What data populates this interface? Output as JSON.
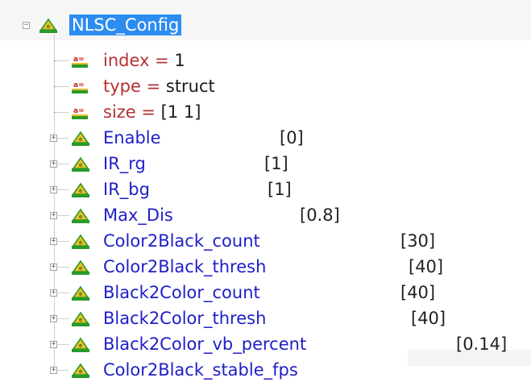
{
  "tree": {
    "root": {
      "label": "NLSC_Config",
      "expander": "−",
      "icon": "struct-icon",
      "fields": [
        {
          "name": "index",
          "eq": " = ",
          "value": "1"
        },
        {
          "name": "type",
          "eq": " = ",
          "value": "struct"
        },
        {
          "name": "size",
          "eq": " = ",
          "value": "[1 1]"
        }
      ],
      "children": [
        {
          "label": "Enable",
          "value": "[0]",
          "expander": "+"
        },
        {
          "label": "IR_rg",
          "value": "[1]",
          "expander": "+"
        },
        {
          "label": "IR_bg",
          "value": "[1]",
          "expander": "+"
        },
        {
          "label": "Max_Dis",
          "value": "[0.8]",
          "expander": "+"
        },
        {
          "label": "Color2Black_count",
          "value": "[30]",
          "expander": "+"
        },
        {
          "label": "Color2Black_thresh",
          "value": "[40]",
          "expander": "+"
        },
        {
          "label": "Black2Color_count",
          "value": "[40]",
          "expander": "+"
        },
        {
          "label": "Black2Color_thresh",
          "value": "[40]",
          "expander": "+"
        },
        {
          "label": "Black2Color_vb_percent",
          "value": "[0.14]",
          "expander": "+"
        },
        {
          "label": "Color2Black_stable_fps",
          "value": "",
          "expander": "+"
        }
      ]
    },
    "colors": {
      "struct_text": "#1e1ec8",
      "field_name": "#b43232",
      "selection": "#2c8cf0",
      "icon_green": "#2a9a2a",
      "icon_yellow": "#f0c020"
    }
  }
}
